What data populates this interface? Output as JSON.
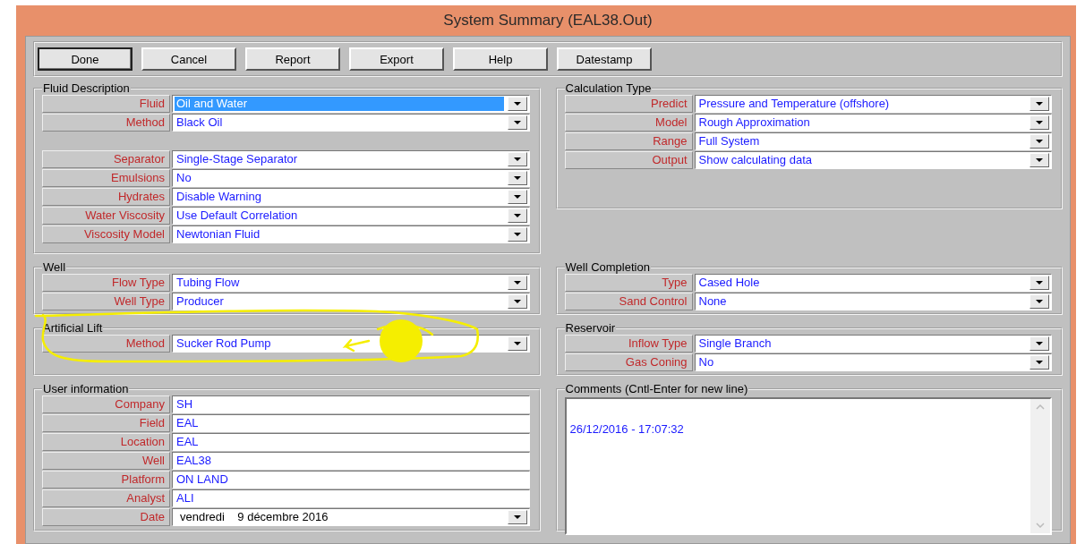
{
  "window": {
    "title": "System Summary (EAL38.Out)"
  },
  "toolbar": {
    "buttons": [
      "Done",
      "Cancel",
      "Report",
      "Export",
      "Help",
      "Datestamp"
    ]
  },
  "left_groups": [
    {
      "title": "Fluid Description",
      "blocks": [
        [
          {
            "label": "Fluid",
            "value": "Oil and Water",
            "kind": "dropdown",
            "focused": true
          },
          {
            "label": "Method",
            "value": "Black Oil",
            "kind": "dropdown",
            "focused": false
          }
        ],
        [
          {
            "label": "Separator",
            "value": "Single-Stage Separator",
            "kind": "dropdown",
            "focused": false
          },
          {
            "label": "Emulsions",
            "value": "No",
            "kind": "dropdown",
            "focused": false
          },
          {
            "label": "Hydrates",
            "value": "Disable Warning",
            "kind": "dropdown",
            "focused": false
          },
          {
            "label": "Water Viscosity",
            "value": "Use Default Correlation",
            "kind": "dropdown",
            "focused": false
          },
          {
            "label": "Viscosity Model",
            "value": "Newtonian Fluid",
            "kind": "dropdown",
            "focused": false
          }
        ]
      ]
    },
    {
      "title": "Well",
      "blocks": [
        [
          {
            "label": "Flow Type",
            "value": "Tubing Flow",
            "kind": "dropdown",
            "focused": false
          },
          {
            "label": "Well Type",
            "value": "Producer",
            "kind": "dropdown",
            "focused": false
          }
        ]
      ]
    },
    {
      "title": "Artificial Lift",
      "blocks": [
        [
          {
            "label": "Method",
            "value": "Sucker Rod Pump",
            "kind": "dropdown",
            "focused": false
          }
        ]
      ]
    },
    {
      "title": "User information",
      "blocks": [
        [
          {
            "label": "Company",
            "value": "SH",
            "kind": "text",
            "focused": false
          },
          {
            "label": "Field",
            "value": "EAL",
            "kind": "text",
            "focused": false
          },
          {
            "label": "Location",
            "value": "EAL",
            "kind": "text",
            "focused": false
          },
          {
            "label": "Well",
            "value": "EAL38",
            "kind": "text",
            "focused": false
          },
          {
            "label": "Platform",
            "value": "ON LAND",
            "kind": "text",
            "focused": false
          },
          {
            "label": "Analyst",
            "value": "ALI",
            "kind": "text",
            "focused": false
          },
          {
            "label": "Date",
            "value": "vendredi    9 décembre 2016",
            "kind": "date",
            "focused": false
          }
        ]
      ]
    }
  ],
  "right_groups": [
    {
      "title": "Calculation Type",
      "blocks": [
        [
          {
            "label": "Predict",
            "value": "Pressure and Temperature (offshore)",
            "kind": "dropdown",
            "focused": false
          },
          {
            "label": "Model",
            "value": "Rough Approximation",
            "kind": "dropdown",
            "focused": false
          },
          {
            "label": "Range",
            "value": "Full System",
            "kind": "dropdown",
            "focused": false
          },
          {
            "label": "Output",
            "value": "Show calculating data",
            "kind": "dropdown",
            "focused": false
          }
        ]
      ]
    },
    {
      "title": "Well Completion",
      "blocks": [
        [
          {
            "label": "Type",
            "value": "Cased Hole",
            "kind": "dropdown",
            "focused": false
          },
          {
            "label": "Sand Control",
            "value": "None",
            "kind": "dropdown",
            "focused": false
          }
        ]
      ]
    },
    {
      "title": "Reservoir",
      "blocks": [
        [
          {
            "label": "Inflow Type",
            "value": "Single Branch",
            "kind": "dropdown",
            "focused": false
          },
          {
            "label": "Gas Coning",
            "value": "No",
            "kind": "dropdown",
            "focused": false
          }
        ]
      ]
    },
    {
      "title": "Comments (Cntl-Enter for new line)",
      "comment": "26/12/2016 - 17:07:32"
    }
  ]
}
